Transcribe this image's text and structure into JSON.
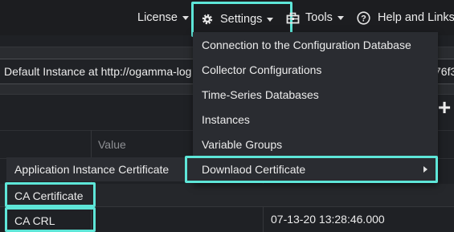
{
  "nav": {
    "license": "License",
    "settings": "Settings",
    "tools": "Tools",
    "help": "Help and Links"
  },
  "instance_url_text": "Default Instance at http://ogamma-log",
  "instance_url_tail": "76f3",
  "add_symbol": "+",
  "grid": {
    "value_header": "Value",
    "timestamp": "07-13-20 13:28:46.000"
  },
  "settings_menu": [
    "Connection to the Configuration Database",
    "Collector Configurations",
    "Time-Series Databases",
    "Instances",
    "Variable Groups",
    "Downlaod Certificate"
  ],
  "certificate_submenu": {
    "items": [
      "Application Instance Certificate",
      "CA Certificate",
      "CA CRL"
    ]
  },
  "colors": {
    "highlight": "#5ee6d8",
    "background": "#1f2125",
    "menu_bg": "#2a2c31"
  },
  "icons": {
    "settings": "gear-icon",
    "tools": "toolbox-icon",
    "help": "question-circle-icon",
    "submenu": "chevron-right-icon",
    "add": "plus-icon"
  }
}
